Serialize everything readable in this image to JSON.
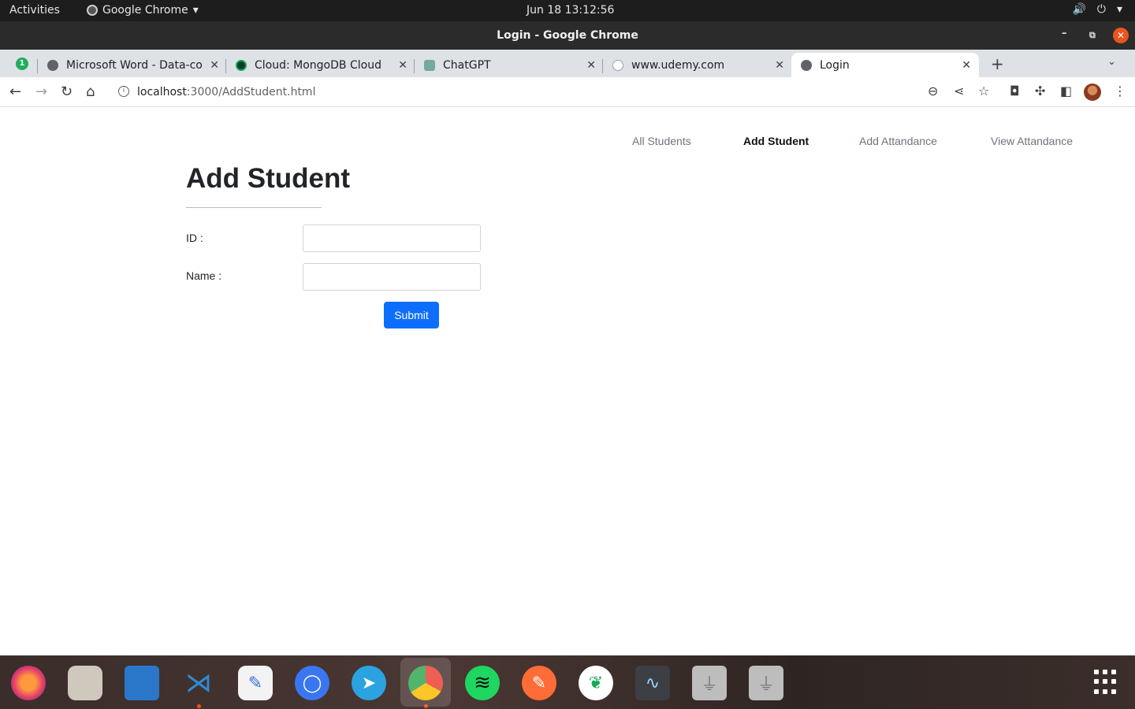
{
  "system_bar": {
    "activities": "Activities",
    "app_menu": "Google Chrome",
    "clock": "Jun 18  13:12:56"
  },
  "window": {
    "title": "Login - Google Chrome"
  },
  "tabs": [
    {
      "label": "Microsoft Word - Data-com",
      "favicon": "globe-icon"
    },
    {
      "label": "Cloud: MongoDB Cloud",
      "favicon": "mongodb-leaf-icon"
    },
    {
      "label": "ChatGPT",
      "favicon": "chatgpt-icon"
    },
    {
      "label": "www.udemy.com",
      "favicon": "info-icon"
    },
    {
      "label": "Login",
      "favicon": "globe-icon",
      "active": true
    }
  ],
  "tab_badge": "1",
  "address_bar": {
    "host": "localhost",
    "path": ":3000/AddStudent.html"
  },
  "nav": {
    "all_students": "All Students",
    "add_student": "Add Student",
    "add_attendance": "Add Attandance",
    "view_attendance": "View Attandance"
  },
  "form": {
    "heading": "Add Student",
    "id_label": "ID :",
    "id_value": "",
    "name_label": "Name :",
    "name_value": "",
    "submit_label": "Submit"
  },
  "colors": {
    "accent": "#0d6efd",
    "ubuntu_orange": "#e95420"
  }
}
